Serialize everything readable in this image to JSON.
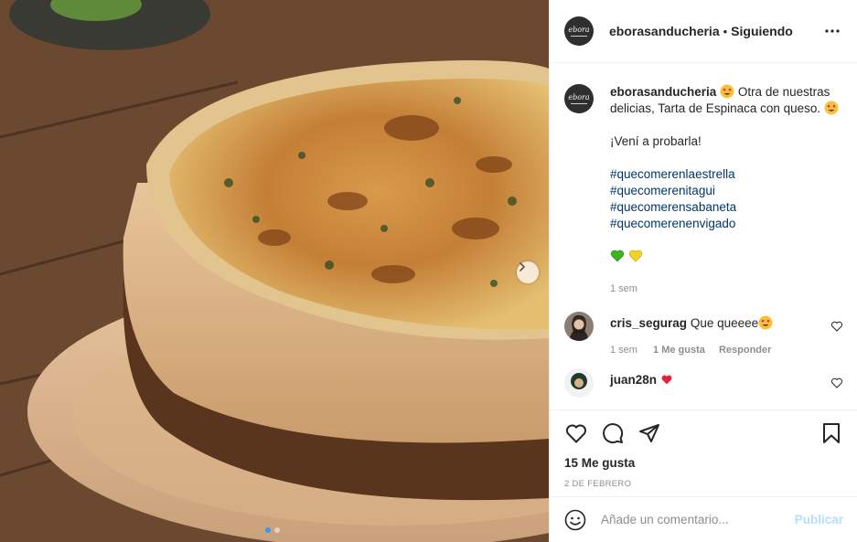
{
  "header": {
    "username": "eborasanducheria",
    "separator": "•",
    "follow_status": "Siguiendo",
    "avatar_logo": "ebora"
  },
  "caption": {
    "username": "eborasanducheria",
    "line1_after_emoji": " Otra de nuestras delicias, Tarta de Espinaca con queso. ",
    "line2": "¡Vení a probarla!",
    "hashtags": [
      "#quecomerenlaestrella",
      "#quecomerenitagui",
      "#quecomerensabaneta",
      "#quecomerenenvigado"
    ],
    "time": "1 sem"
  },
  "comments": [
    {
      "username": "cris_segurag",
      "text": "Que queeee",
      "time": "1 sem",
      "likes": "1 Me gusta",
      "reply_label": "Responder"
    },
    {
      "username": "juan28n",
      "text": ""
    }
  ],
  "stats": {
    "likes": "15 Me gusta",
    "date": "2 de febrero"
  },
  "add_comment": {
    "placeholder": "Añade un comentario...",
    "publish_label": "Publicar"
  },
  "carousel": {
    "current": 1,
    "total": 2
  },
  "icons": [
    "heart-icon",
    "comment-icon",
    "share-icon",
    "bookmark-icon",
    "smiley-icon",
    "more-icon",
    "chevron-right-icon"
  ],
  "colors": {
    "hashtag": "#00376b",
    "publish_disabled": "#b2dffc",
    "muted": "#8e8e8e",
    "carousel_active_dot": "#3897f0"
  }
}
